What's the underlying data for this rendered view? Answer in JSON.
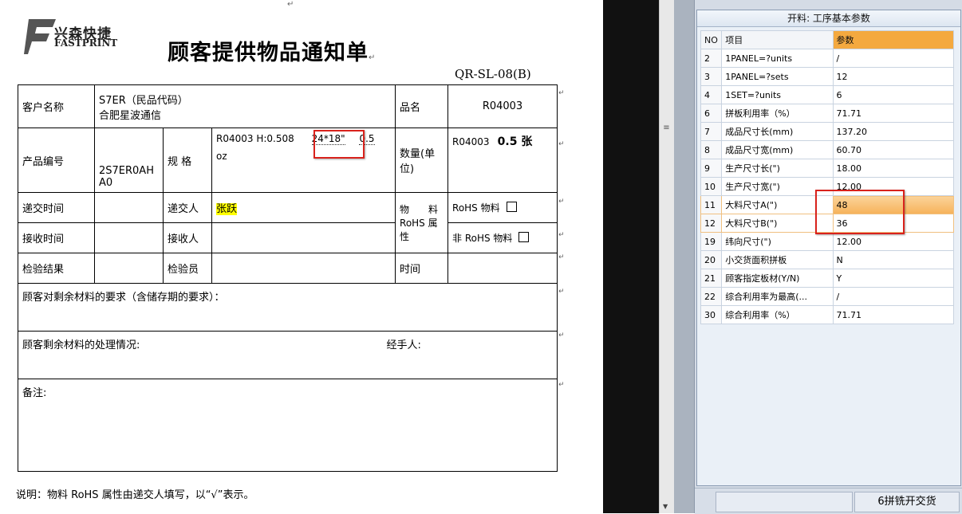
{
  "document": {
    "logo": {
      "cn": "兴森快捷",
      "en": "FASTPRINT"
    },
    "title": "顾客提供物品通知单",
    "form_no": "QR-SL-08(B)",
    "paragraph_mark": "↵",
    "rows": {
      "customer_label": "客户名称",
      "customer_line1": "S7ER（民品代码）",
      "customer_line2": "合肥星波通信",
      "product_name_label": "品名",
      "product_name_value": "R04003",
      "product_no_label": "产品编号",
      "product_no_value": "2S7ER0AHA0",
      "spec_label": "规 格",
      "spec_line1_a": "R04003   H:0.508",
      "spec_line1_b": "24*18\"",
      "spec_line1_c": "0.5",
      "spec_line2": "oz",
      "qty_label": "数量(单位)",
      "qty_value_a": "R04003",
      "qty_value_b": "0.5 张",
      "submit_time_label": "递交时间",
      "submitter_label": "递交人",
      "submitter_value": "张跃",
      "material_rohs_label": "物　　料 RoHS 属性",
      "rohs_material": "RoHS 物料",
      "non_rohs_material": "非 RoHS 物料",
      "receive_time_label": "接收时间",
      "receiver_label": "接收人",
      "inspect_result_label": "检验结果",
      "inspector_label": "检验员",
      "time_label": "时间",
      "customer_requirement": "顾客对剩余材料的要求（含储存期的要求）：",
      "handling": "顾客剩余材料的处理情况:",
      "handler": "经手人:",
      "remarks": "备注:"
    },
    "note": "说明：物料 RoHS 属性由递交人填写，以“√”表示。"
  },
  "panel": {
    "title": "开料: 工序基本参数",
    "columns": [
      "NO",
      "项目",
      "参数"
    ],
    "rows": [
      {
        "no": "2",
        "item": "1PANEL=?units",
        "value": "/"
      },
      {
        "no": "3",
        "item": "1PANEL=?sets",
        "value": "12"
      },
      {
        "no": "4",
        "item": "1SET=?units",
        "value": "6"
      },
      {
        "no": "6",
        "item": "拼板利用率（%）",
        "value": "71.71"
      },
      {
        "no": "7",
        "item": "成品尺寸长(mm)",
        "value": "137.20"
      },
      {
        "no": "8",
        "item": "成品尺寸宽(mm)",
        "value": "60.70"
      },
      {
        "no": "9",
        "item": "生产尺寸长(\")",
        "value": "18.00"
      },
      {
        "no": "10",
        "item": "生产尺寸宽(\")",
        "value": "12.00"
      },
      {
        "no": "11",
        "item": "大料尺寸A(\")",
        "value": "48"
      },
      {
        "no": "12",
        "item": "大料尺寸B(\")",
        "value": "36"
      },
      {
        "no": "19",
        "item": "纬向尺寸(\")",
        "value": "12.00"
      },
      {
        "no": "20",
        "item": "小交货面积拼板",
        "value": "N"
      },
      {
        "no": "21",
        "item": "顾客指定板材(Y/N)",
        "value": "Y"
      },
      {
        "no": "22",
        "item": "综合利用率为最高(...",
        "value": "/"
      },
      {
        "no": "30",
        "item": "综合利用率（%）",
        "value": "71.71"
      }
    ],
    "status": "6拼铣开交货",
    "colors": {
      "highlight": "#f6b25a",
      "annotation": "#d9221c",
      "header_param": "#f4a93f"
    }
  }
}
